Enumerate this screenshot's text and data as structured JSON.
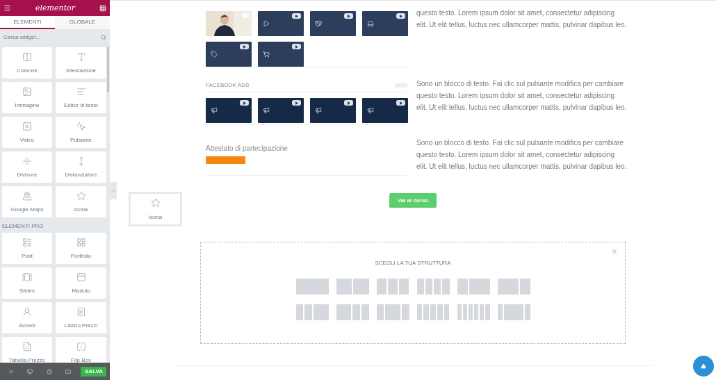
{
  "sidebar": {
    "logo": "elementor",
    "tabs": [
      {
        "label": "ELEMENTI",
        "selected": true
      },
      {
        "label": "GLOBALE",
        "selected": false
      }
    ],
    "search": {
      "placeholder": "Cerca widget..."
    },
    "groups": [
      {
        "widgets": [
          {
            "label": "Colonne"
          },
          {
            "label": "Intestazione"
          },
          {
            "label": "Immagine"
          },
          {
            "label": "Editor di testo"
          },
          {
            "label": "Video"
          },
          {
            "label": "Pulsante"
          },
          {
            "label": "Divisore"
          },
          {
            "label": "Distanziatore"
          },
          {
            "label": "Google Maps"
          },
          {
            "label": "Icona"
          }
        ]
      },
      {
        "title": "ELEMENTI PRO",
        "widgets": [
          {
            "label": "Post"
          },
          {
            "label": "Portfolio"
          },
          {
            "label": "Slides"
          },
          {
            "label": "Modulo"
          },
          {
            "label": "Accedi"
          },
          {
            "label": "Listino Prezzi"
          },
          {
            "label": "Tabella Prezzo"
          },
          {
            "label": "Flip Box"
          }
        ]
      }
    ],
    "footer": {
      "save_button": "SALVA"
    }
  },
  "canvas": {
    "rows": [
      {
        "kind": "videos",
        "thumbnails": [
          {
            "kind": "picture"
          },
          {
            "kind": "video"
          },
          {
            "kind": "video"
          },
          {
            "kind": "video"
          },
          {
            "kind": "video"
          },
          {
            "kind": "video"
          }
        ],
        "text": "questo testo. Lorem ipsum dolor sit amet, consectetur adipiscing\nelit. Ut elit tellus, luctus nec ullamcorper mattis, pulvinar dapibus leo."
      },
      {
        "kind": "videos",
        "title": "FACEBOOK ADS",
        "thumbnails": [
          {
            "kind": "video"
          },
          {
            "kind": "video"
          },
          {
            "kind": "video"
          },
          {
            "kind": "video"
          }
        ],
        "text": "Sono un blocco di testo. Fai clic sul pulsante modifica per cambiare\nquesto testo. Lorem ipsum dolor sit amet, consectetur adipiscing\nelit. Ut elit tellus, luctus nec ullamcorper mattis, pulvinar dapibus leo."
      },
      {
        "kind": "certificate",
        "title": "Attestato di partecipazione",
        "text": "Sono un blocco di testo. Fai clic sul pulsante modifica per cambiare\nquesto testo. Lorem ipsum dolor sit amet, consectetur adipiscing\nelit. Ut elit tellus, luctus nec ullamcorper mattis, pulvinar dapibus leo."
      }
    ],
    "cta_button": "Vai al corso",
    "dragged_widget": {
      "label": "Icona"
    },
    "structure_picker": {
      "title": "SCEGLI LA TUA STRUTTURA",
      "close": "×"
    }
  }
}
